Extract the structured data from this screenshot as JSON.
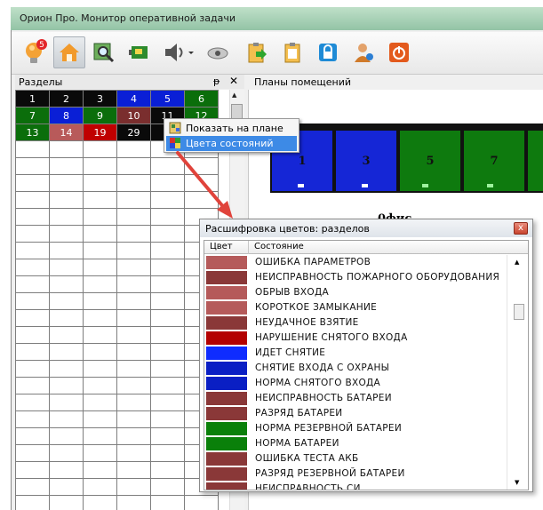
{
  "window": {
    "title": "Орион Про. Монитор оперативной задачи"
  },
  "toolbar": {
    "alarm_badge": "5",
    "buttons": [
      {
        "icon": "lightbulb-alarm-icon"
      },
      {
        "icon": "home-icon"
      },
      {
        "icon": "search-window-icon"
      },
      {
        "icon": "device-board-icon"
      },
      {
        "icon": "speaker-icon"
      },
      {
        "icon": "camera-icon"
      },
      {
        "icon": "clipboard-arrow-icon"
      },
      {
        "icon": "clipboard-icon"
      },
      {
        "icon": "lock-icon"
      },
      {
        "icon": "user-icon"
      },
      {
        "icon": "power-icon"
      }
    ]
  },
  "sections_panel": {
    "title": "Разделы",
    "pin_glyph": "ᵽ",
    "close_glyph": "✕",
    "rows": [
      [
        {
          "n": "1",
          "color": "#0a0a0a"
        },
        {
          "n": "2",
          "color": "#0a0a0a"
        },
        {
          "n": "3",
          "color": "#0a0a0a"
        },
        {
          "n": "4",
          "color": "#0a1fd6"
        },
        {
          "n": "5",
          "color": "#0a1fd6"
        },
        {
          "n": "6",
          "color": "#0b6e0b"
        }
      ],
      [
        {
          "n": "7",
          "color": "#0b6e0b"
        },
        {
          "n": "8",
          "color": "#0a1fd6"
        },
        {
          "n": "9",
          "color": "#0b6e0b"
        },
        {
          "n": "10",
          "color": "#7a2e2e"
        },
        {
          "n": "11",
          "color": "#0a0a0a"
        },
        {
          "n": "12",
          "color": "#0b6e0b"
        }
      ],
      [
        {
          "n": "13",
          "color": "#0b6e0b"
        },
        {
          "n": "14",
          "color": "#b85a5a"
        },
        {
          "n": "19",
          "color": "#c00000"
        },
        {
          "n": "29",
          "color": "#0a0a0a"
        },
        {
          "n": "",
          "color": "#0a0a0a"
        },
        {
          "n": "",
          "color": "#0a0a0a"
        }
      ]
    ]
  },
  "context_menu": {
    "items": [
      {
        "label": "Показать на плане"
      },
      {
        "label": "Цвета состояний"
      }
    ]
  },
  "plans_panel": {
    "title": "Планы помещений",
    "rooms": [
      {
        "label": "1",
        "color": "#1526d6"
      },
      {
        "label": "3",
        "color": "#1526d6"
      },
      {
        "label": "5",
        "color": "#0e7a0e"
      },
      {
        "label": "7",
        "color": "#0e7a0e"
      }
    ],
    "hidden_label": "0фис"
  },
  "legend_popup": {
    "title": "Расшифровка цветов: разделов",
    "close_glyph": "x",
    "columns": {
      "color": "Цвет",
      "state": "Состояние"
    },
    "items": [
      {
        "color": "#b55a5a",
        "state": "ОШИБКА ПАРАМЕТРОВ"
      },
      {
        "color": "#8a3838",
        "state": "НЕИСПРАВНОСТЬ ПОЖАРНОГО ОБОРУДОВАНИЯ"
      },
      {
        "color": "#b55a5a",
        "state": "ОБРЫВ ВХОДА"
      },
      {
        "color": "#b55a5a",
        "state": "КОРОТКОЕ ЗАМЫКАНИЕ"
      },
      {
        "color": "#8a3838",
        "state": "НЕУДАЧНОЕ ВЗЯТИЕ"
      },
      {
        "color": "#b30000",
        "state": "НАРУШЕНИЕ СНЯТОГО ВХОДА"
      },
      {
        "color": "#0f2cff",
        "state": "ИДЕТ СНЯТИЕ"
      },
      {
        "color": "#0a1fc4",
        "state": "СНЯТИЕ ВХОДА С ОХРАНЫ"
      },
      {
        "color": "#0a1fc4",
        "state": "НОРМА СНЯТОГО ВХОДА"
      },
      {
        "color": "#8a3838",
        "state": "НЕИСПРАВНОСТЬ БАТАРЕИ"
      },
      {
        "color": "#8a3838",
        "state": "РАЗРЯД БАТАРЕИ"
      },
      {
        "color": "#0a800a",
        "state": "НОРМА РЕЗЕРВНОЙ БАТАРЕИ"
      },
      {
        "color": "#0a800a",
        "state": "НОРМА БАТАРЕИ"
      },
      {
        "color": "#8a3838",
        "state": "ОШИБКА ТЕСТА АКБ"
      },
      {
        "color": "#8a3838",
        "state": "РАЗРЯД РЕЗЕРВНОЙ БАТАРЕИ"
      },
      {
        "color": "#8a3838",
        "state": "НЕИСПРАВНОСТЬ СИ"
      }
    ]
  }
}
